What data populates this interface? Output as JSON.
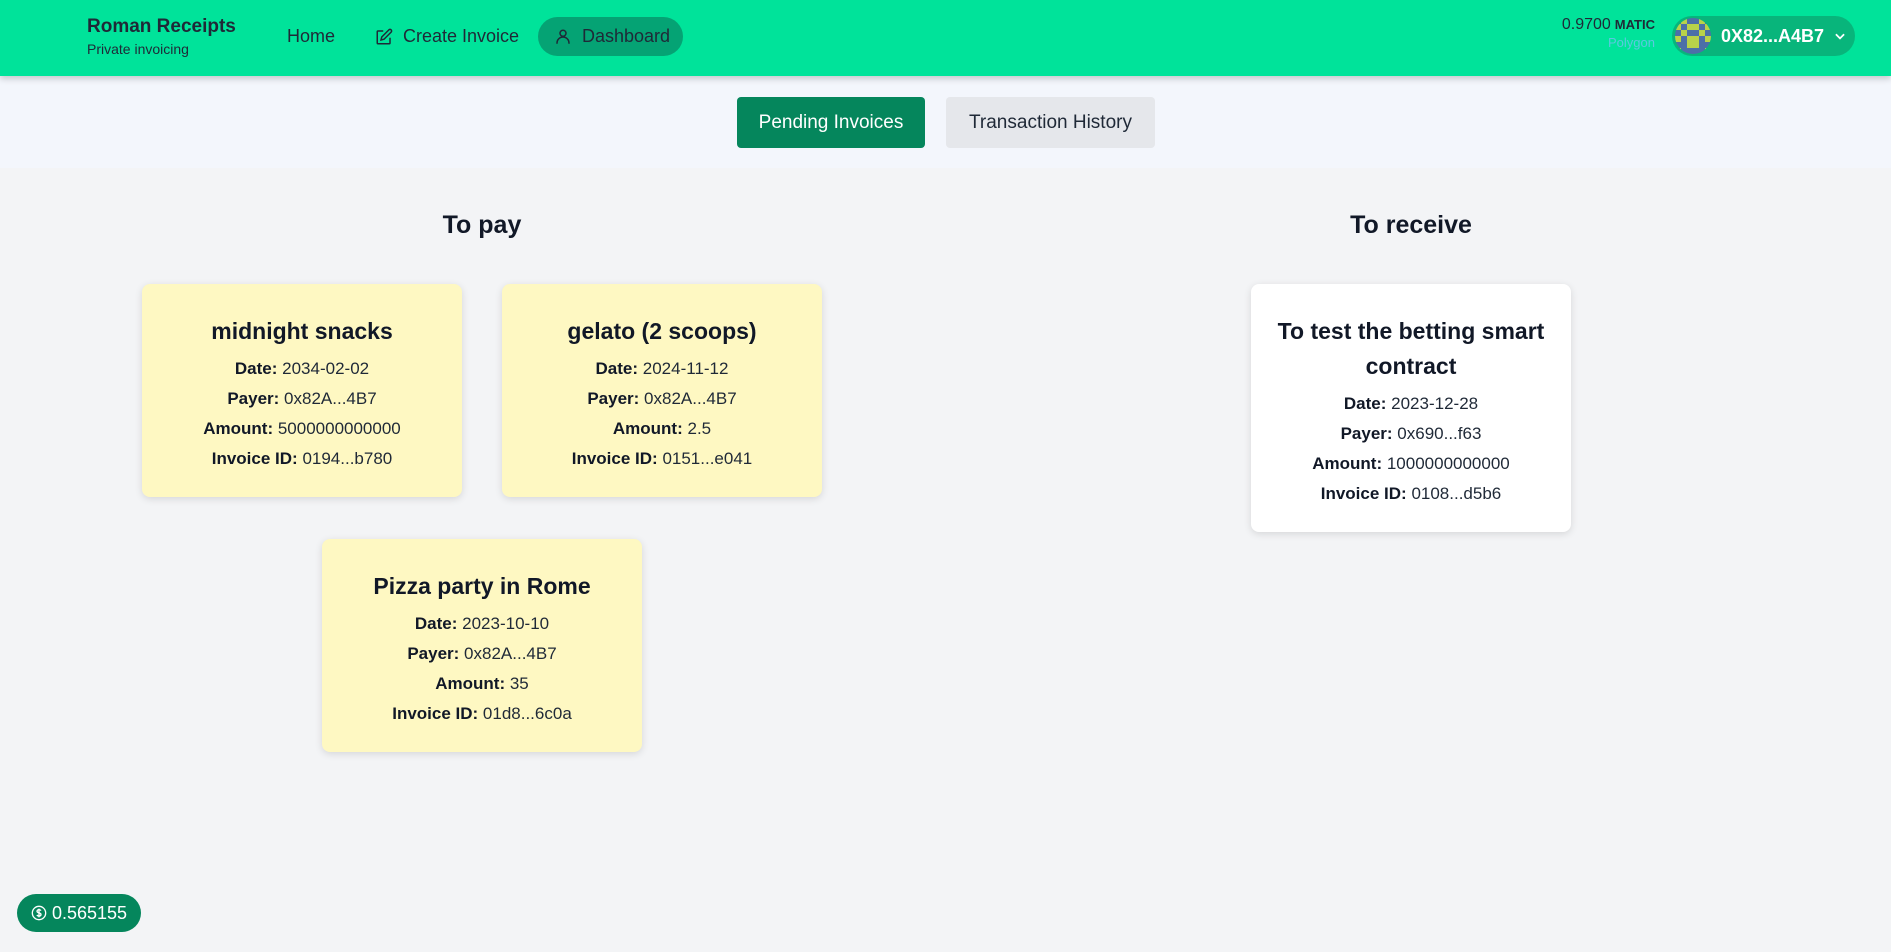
{
  "brand": {
    "title": "Roman Receipts",
    "subtitle": "Private invoicing"
  },
  "nav": {
    "home": "Home",
    "create_invoice": "Create Invoice",
    "dashboard": "Dashboard"
  },
  "wallet": {
    "balance": "0.9700",
    "unit": "MATIC",
    "network": "Polygon",
    "account": "0X82...A4B7"
  },
  "tabs": {
    "pending": "Pending Invoices",
    "history": "Transaction History"
  },
  "sections": {
    "to_pay": "To pay",
    "to_receive": "To receive"
  },
  "labels": {
    "date": "Date:",
    "payer": "Payer:",
    "amount": "Amount:",
    "invoice_id": "Invoice ID:"
  },
  "to_pay": [
    {
      "title": "midnight snacks",
      "date": "2034-02-02",
      "payer": "0x82A...4B7",
      "amount": "5000000000000",
      "invoice_id": "0194...b780"
    },
    {
      "title": "gelato (2 scoops)",
      "date": "2024-11-12",
      "payer": "0x82A...4B7",
      "amount": "2.5",
      "invoice_id": "0151...e041"
    },
    {
      "title": "Pizza party in Rome",
      "date": "2023-10-10",
      "payer": "0x82A...4B7",
      "amount": "35",
      "invoice_id": "01d8...6c0a"
    }
  ],
  "to_receive": [
    {
      "title": "To test the betting smart contract",
      "date": "2023-12-28",
      "payer": "0x690...f63",
      "amount": "1000000000000",
      "invoice_id": "0108...d5b6"
    }
  ],
  "floating_balance": "0.565155",
  "colors": {
    "navbar": "#00e39a",
    "accent_green": "#05865c",
    "pay_card": "#fef8c2",
    "receive_card": "#ffffff"
  }
}
